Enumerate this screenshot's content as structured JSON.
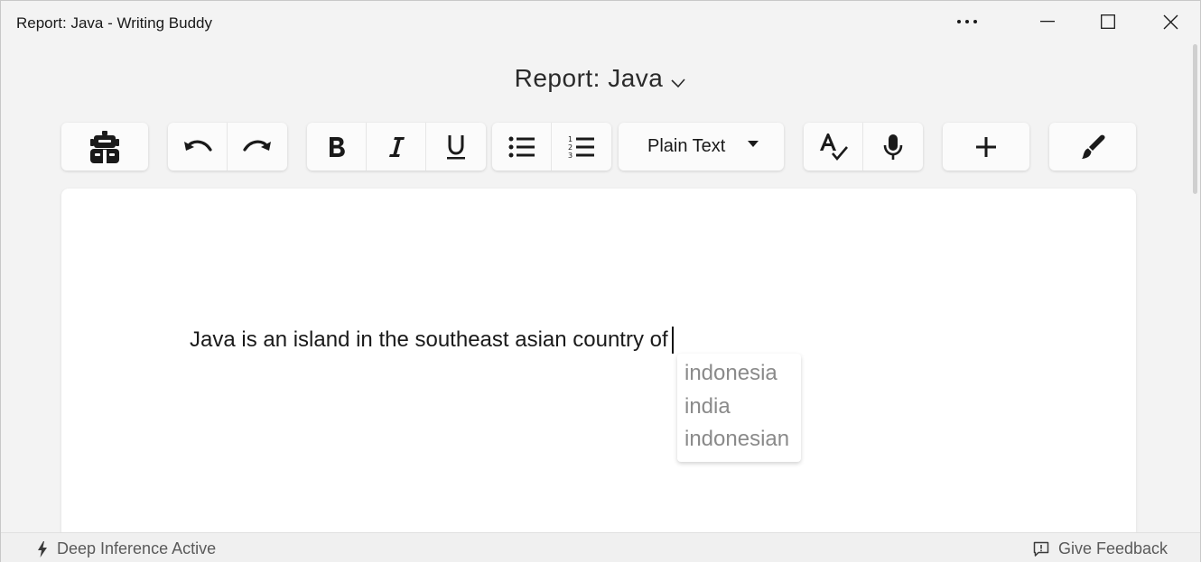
{
  "window": {
    "title": "Report: Java - Writing Buddy",
    "controls": [
      "more-icon",
      "minimize-icon",
      "maximize-icon",
      "close-icon"
    ]
  },
  "document": {
    "title": "Report: Java"
  },
  "toolbar": {
    "groups": [
      [
        "robot-icon"
      ],
      [
        "undo-icon",
        "redo-icon"
      ],
      [
        "bold-icon",
        "italic-icon",
        "underline-icon"
      ],
      [
        "bulleted-list-icon",
        "numbered-list-icon"
      ],
      [
        "format-dropdown"
      ],
      [
        "spellcheck-icon",
        "microphone-icon"
      ],
      [
        "plus-icon"
      ],
      [
        "brush-icon"
      ]
    ],
    "format_selected": "Plain Text"
  },
  "editor": {
    "text": "Java is an island in the southeast asian country of",
    "suggestions": [
      "indonesia",
      "india",
      "indonesian"
    ]
  },
  "status": {
    "left": "Deep Inference Active",
    "right": "Give Feedback"
  }
}
